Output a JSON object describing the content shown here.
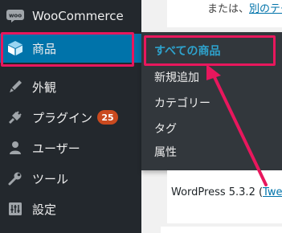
{
  "sidebar": {
    "items": [
      {
        "label": "WooCommerce",
        "icon": "woocommerce-icon"
      },
      {
        "label": "商品",
        "icon": "products-box-icon"
      },
      {
        "label": "外観",
        "icon": "paintbrush-icon"
      },
      {
        "label": "プラグイン",
        "icon": "plugin-icon",
        "badge": "25"
      },
      {
        "label": "ユーザー",
        "icon": "user-icon"
      },
      {
        "label": "ツール",
        "icon": "wrench-icon"
      },
      {
        "label": "設定",
        "icon": "settings-sliders-icon"
      }
    ]
  },
  "submenu": {
    "items": [
      {
        "label": "すべての商品"
      },
      {
        "label": "新規追加"
      },
      {
        "label": "カテゴリー"
      },
      {
        "label": "タグ"
      },
      {
        "label": "属性"
      }
    ]
  },
  "content": {
    "top_text": "または、",
    "top_link": "別のテーマ",
    "version_text": "WordPress 5.3.2 (",
    "version_link": "Twe"
  },
  "annotation": {
    "highlight_color": "#e8175d",
    "accent_color": "#0073aa",
    "sidebar_bg": "#23282d"
  }
}
